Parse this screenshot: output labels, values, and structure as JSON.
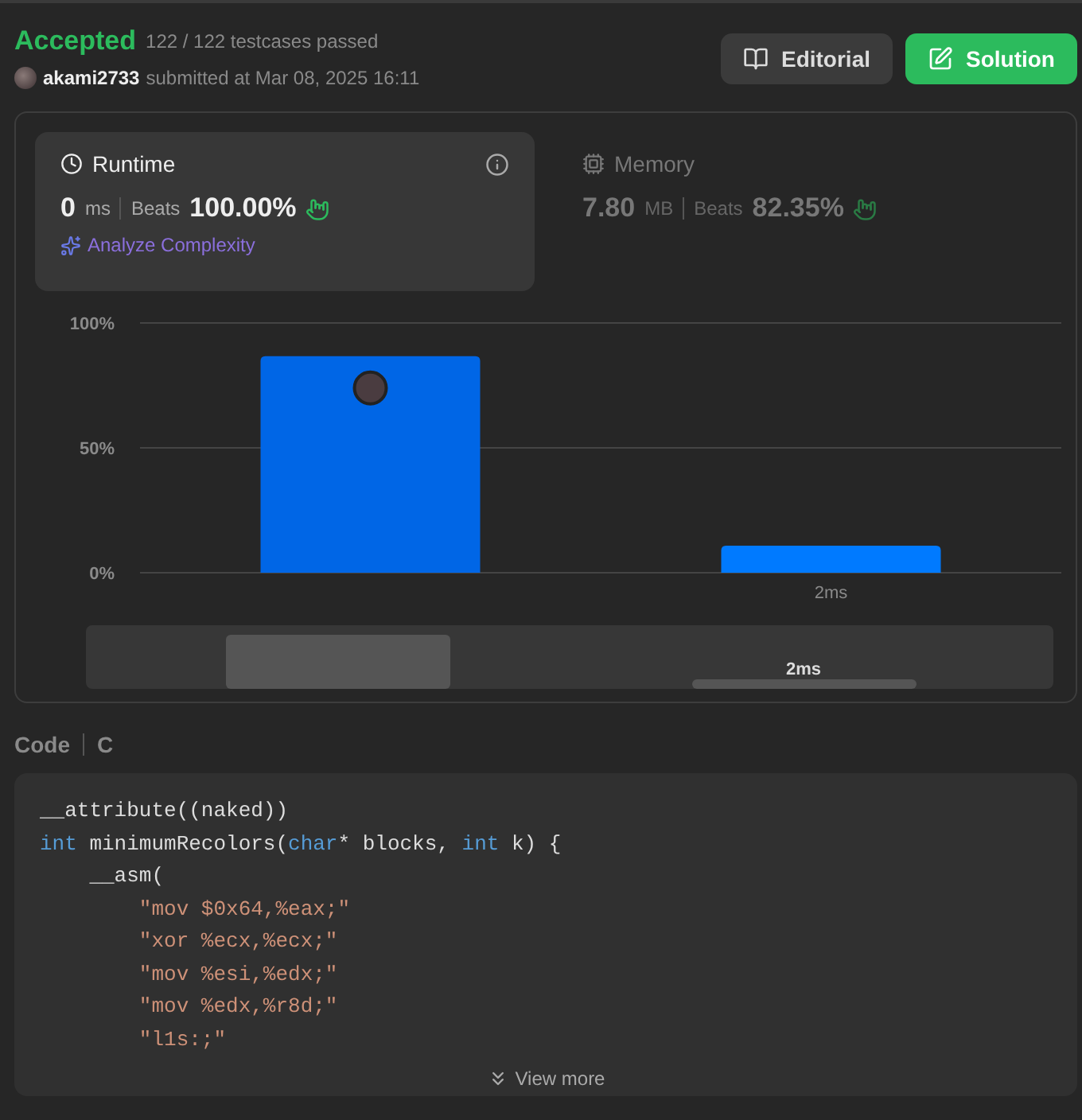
{
  "status": {
    "verdict": "Accepted",
    "testcases": "122 / 122 testcases passed",
    "user": "akami2733",
    "submitted": "submitted at Mar 08, 2025 16:11"
  },
  "buttons": [
    {
      "label": "Editorial",
      "kind": "secondary"
    },
    {
      "label": "Solution",
      "kind": "primary"
    }
  ],
  "metrics": [
    {
      "title": "Runtime",
      "selected": true,
      "value": "0",
      "unit": "ms",
      "beats_label": "Beats",
      "beats": "100.00%",
      "link": "Analyze Complexity"
    },
    {
      "title": "Memory",
      "selected": false,
      "value": "7.80",
      "unit": "MB",
      "beats_label": "Beats",
      "beats": "82.35%"
    }
  ],
  "chart_data": {
    "type": "bar",
    "categories": [
      null,
      "2ms"
    ],
    "values": [
      86.7,
      10.8
    ],
    "ylim": [
      0,
      100
    ],
    "yticks": [
      {
        "value": 0,
        "label": "0%"
      },
      {
        "value": 50,
        "label": "50%"
      },
      {
        "value": 100,
        "label": "100%"
      }
    ]
  },
  "overview": {
    "label": "2ms"
  },
  "code": {
    "label": "Code",
    "language": "C",
    "lines": [
      [
        {
          "kind": "plain",
          "text": "__attribute((naked))"
        }
      ],
      [
        {
          "kind": "keyword",
          "text": "int"
        },
        {
          "kind": "plain",
          "text": " minimumRecolors("
        },
        {
          "kind": "keyword",
          "text": "char"
        },
        {
          "kind": "plain",
          "text": "* blocks, "
        },
        {
          "kind": "keyword",
          "text": "int"
        },
        {
          "kind": "plain",
          "text": " k) {"
        }
      ],
      [
        {
          "kind": "plain",
          "text": "    __asm("
        }
      ],
      [
        {
          "kind": "string",
          "text": "        \"mov $0x64,%eax;\""
        }
      ],
      [
        {
          "kind": "string",
          "text": "        \"xor %ecx,%ecx;\""
        }
      ],
      [
        {
          "kind": "string",
          "text": "        \"mov %esi,%edx;\""
        }
      ],
      [
        {
          "kind": "string",
          "text": "        \"mov %edx,%r8d;\""
        }
      ],
      [
        {
          "kind": "string",
          "text": "        \"l1s:;\""
        }
      ]
    ],
    "more": "View more"
  }
}
